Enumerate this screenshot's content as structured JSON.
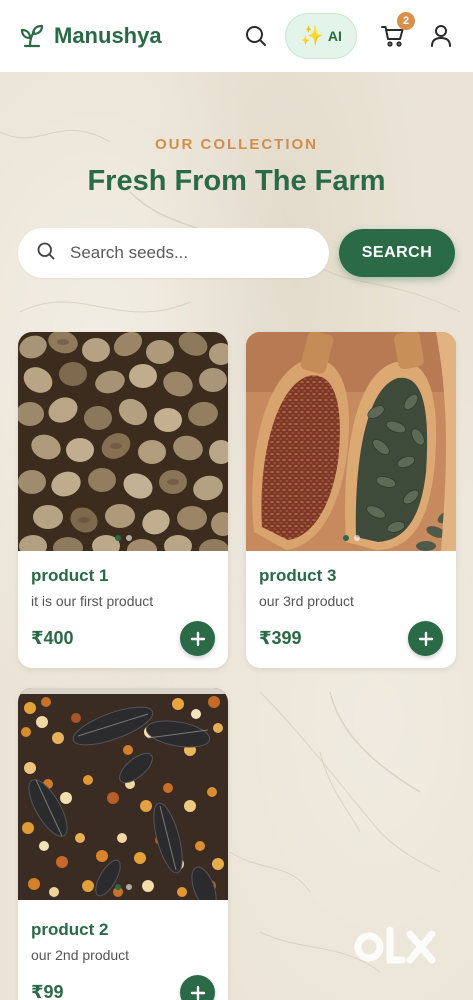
{
  "header": {
    "brand": "Manushya",
    "ai_label": "AI",
    "cart_count": "2"
  },
  "section": {
    "eyebrow": "OUR COLLECTION",
    "title": "Fresh From The Farm"
  },
  "search": {
    "placeholder": "Search seeds...",
    "button_label": "SEARCH"
  },
  "products": [
    {
      "name": "product 1",
      "description": "it is our first product",
      "price": "₹400"
    },
    {
      "name": "product 3",
      "description": "our 3rd product",
      "price": "₹399"
    },
    {
      "name": "product 2",
      "description": "our 2nd product",
      "price": "₹99"
    }
  ],
  "watermark": "olx",
  "colors": {
    "brand_green": "#2a6a47",
    "accent_orange": "#d28e4a",
    "ai_bg": "#e3f4e9"
  },
  "icons": [
    "sprout-icon",
    "search-icon",
    "sparkles-icon",
    "cart-icon",
    "user-icon",
    "plus-icon"
  ]
}
